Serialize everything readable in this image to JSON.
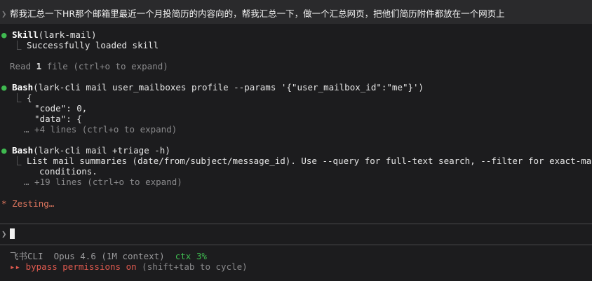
{
  "prompt": {
    "chevron": "❯",
    "text": "帮我汇总一下HR那个邮箱里最近一个月投简历的内容向的，帮我汇总一下，做一个汇总网页，把他们简历附件都放在一个网页上"
  },
  "transcript": {
    "bullet": "●",
    "branch": "⎿",
    "skill": {
      "name": "Skill",
      "args": "(lark-mail)",
      "result": "Successfully loaded skill"
    },
    "read": {
      "prefix": "Read ",
      "count": "1",
      "suffix": " file (ctrl+o to expand)"
    },
    "bash1": {
      "name": "Bash",
      "args": "(lark-cli mail user_mailboxes profile --params '{\"user_mailbox_id\":\"me\"}')",
      "output": [
        "{",
        "  \"code\": 0,",
        "  \"data\": {"
      ],
      "more": "… +4 lines (ctrl+o to expand)"
    },
    "bash2": {
      "name": "Bash",
      "args": "(lark-cli mail +triage -h)",
      "output_line1": "List mail summaries (date/from/subject/message_id). Use --query for full-text search, --filter for exact-match",
      "output_line2": "conditions.",
      "more": "… +19 lines (ctrl+o to expand)"
    },
    "spinner": {
      "glyph": "*",
      "text": "Zesting…"
    }
  },
  "input": {
    "chevron": "❯"
  },
  "status_bar": {
    "app": "飞书CLI",
    "model": "Opus 4.6 (1M context)",
    "ctx": "ctx 3%",
    "bypass_marks": "▸▸",
    "bypass_label": "bypass permissions on",
    "bypass_hint": " (shift+tab to cycle)"
  }
}
